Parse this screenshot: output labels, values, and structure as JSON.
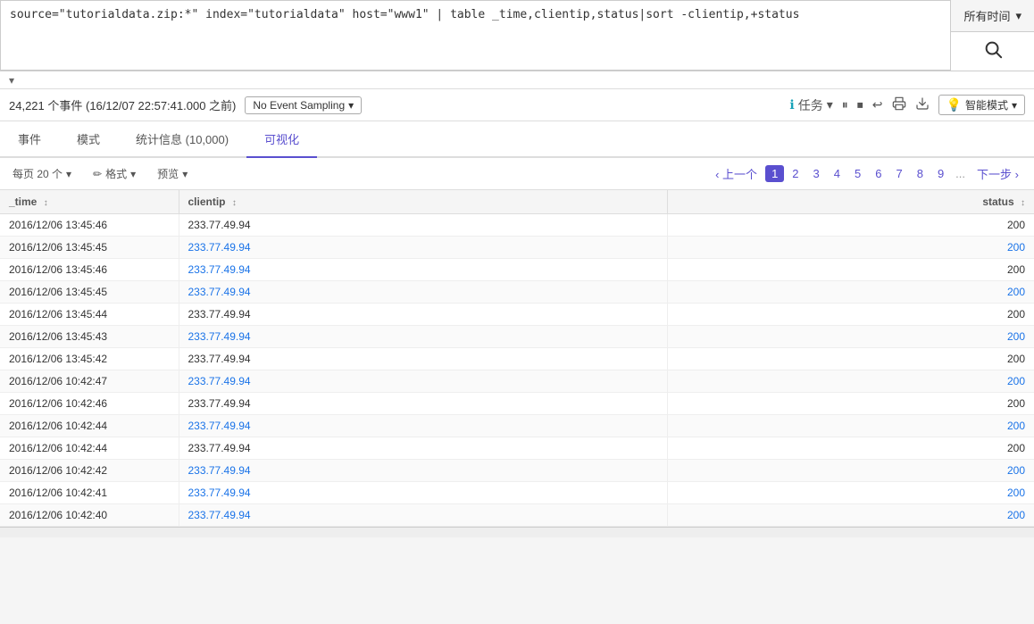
{
  "searchbar": {
    "query": "source=\"tutorialdata.zip:*\" index=\"tutorialdata\" host=\"www1\" | table _time,clientip,status|sort -clientip,+status",
    "time_range": "所有时间",
    "search_icon": "🔍"
  },
  "status": {
    "event_count": "24,221 个事件 (16/12/07 22:57:41.000 之前)",
    "sampling_label": "No Event Sampling",
    "tasks_label": "任务",
    "pause_icon": "⏸",
    "stop_icon": "⏹",
    "share_icon": "↩",
    "print_icon": "🖨",
    "download_icon": "⬇",
    "smart_mode_label": "智能模式"
  },
  "tabs": [
    {
      "label": "事件",
      "active": false
    },
    {
      "label": "模式",
      "active": false
    },
    {
      "label": "统计信息 (10,000)",
      "active": false
    },
    {
      "label": "可视化",
      "active": true
    }
  ],
  "toolbar": {
    "per_page_label": "每页 20 个",
    "format_label": "格式",
    "preview_label": "预览",
    "prev_label": "上一个",
    "next_label": "下一步",
    "pages": [
      "1",
      "2",
      "3",
      "4",
      "5",
      "6",
      "7",
      "8",
      "9"
    ],
    "current_page": "1",
    "dots": "..."
  },
  "table": {
    "columns": [
      {
        "label": "_time",
        "sortable": true
      },
      {
        "label": "clientip",
        "sortable": true
      },
      {
        "label": "status",
        "sortable": true
      }
    ],
    "rows": [
      {
        "time": "2016/12/06 13:45:46",
        "clientip": "233.77.49.94",
        "status": "200",
        "ip_blue": false,
        "status_blue": false
      },
      {
        "time": "2016/12/06 13:45:45",
        "clientip": "233.77.49.94",
        "status": "200",
        "ip_blue": true,
        "status_blue": true
      },
      {
        "time": "2016/12/06 13:45:46",
        "clientip": "233.77.49.94",
        "status": "200",
        "ip_blue": true,
        "status_blue": false
      },
      {
        "time": "2016/12/06 13:45:45",
        "clientip": "233.77.49.94",
        "status": "200",
        "ip_blue": true,
        "status_blue": true
      },
      {
        "time": "2016/12/06 13:45:44",
        "clientip": "233.77.49.94",
        "status": "200",
        "ip_blue": false,
        "status_blue": false
      },
      {
        "time": "2016/12/06 13:45:43",
        "clientip": "233.77.49.94",
        "status": "200",
        "ip_blue": true,
        "status_blue": true
      },
      {
        "time": "2016/12/06 13:45:42",
        "clientip": "233.77.49.94",
        "status": "200",
        "ip_blue": false,
        "status_blue": false
      },
      {
        "time": "2016/12/06 10:42:47",
        "clientip": "233.77.49.94",
        "status": "200",
        "ip_blue": true,
        "status_blue": true
      },
      {
        "time": "2016/12/06 10:42:46",
        "clientip": "233.77.49.94",
        "status": "200",
        "ip_blue": false,
        "status_blue": false
      },
      {
        "time": "2016/12/06 10:42:44",
        "clientip": "233.77.49.94",
        "status": "200",
        "ip_blue": true,
        "status_blue": true
      },
      {
        "time": "2016/12/06 10:42:44",
        "clientip": "233.77.49.94",
        "status": "200",
        "ip_blue": false,
        "status_blue": false
      },
      {
        "time": "2016/12/06 10:42:42",
        "clientip": "233.77.49.94",
        "status": "200",
        "ip_blue": true,
        "status_blue": true
      },
      {
        "time": "2016/12/06 10:42:41",
        "clientip": "233.77.49.94",
        "status": "200",
        "ip_blue": true,
        "status_blue": true
      },
      {
        "time": "2016/12/06 10:42:40",
        "clientip": "233.77.49.94",
        "status": "200",
        "ip_blue": true,
        "status_blue": true
      }
    ]
  }
}
